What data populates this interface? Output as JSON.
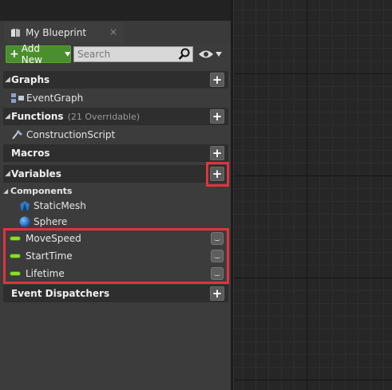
{
  "tab": {
    "title": "My Blueprint",
    "close": "×"
  },
  "toolbar": {
    "add_new_label": "Add New",
    "search_placeholder": "Search"
  },
  "sections": {
    "graphs": {
      "label": "Graphs",
      "items": [
        "EventGraph"
      ]
    },
    "functions": {
      "label": "Functions",
      "note": "(21 Overridable)",
      "items": [
        "ConstructionScript"
      ]
    },
    "macros": {
      "label": "Macros"
    },
    "variables": {
      "label": "Variables",
      "components_label": "Components",
      "components": [
        "StaticMesh",
        "Sphere"
      ],
      "vars": [
        "MoveSpeed",
        "StartTime",
        "Lifetime"
      ]
    },
    "event_dispatchers": {
      "label": "Event Dispatchers"
    }
  },
  "icons": {
    "plus": "+",
    "section_arrow_open": "◢",
    "section_arrow_closed": "◢"
  },
  "colors": {
    "add_new_green": "#4a8f2d",
    "highlight_red": "#e0343d",
    "float_var_green": "#8bdc2c"
  }
}
